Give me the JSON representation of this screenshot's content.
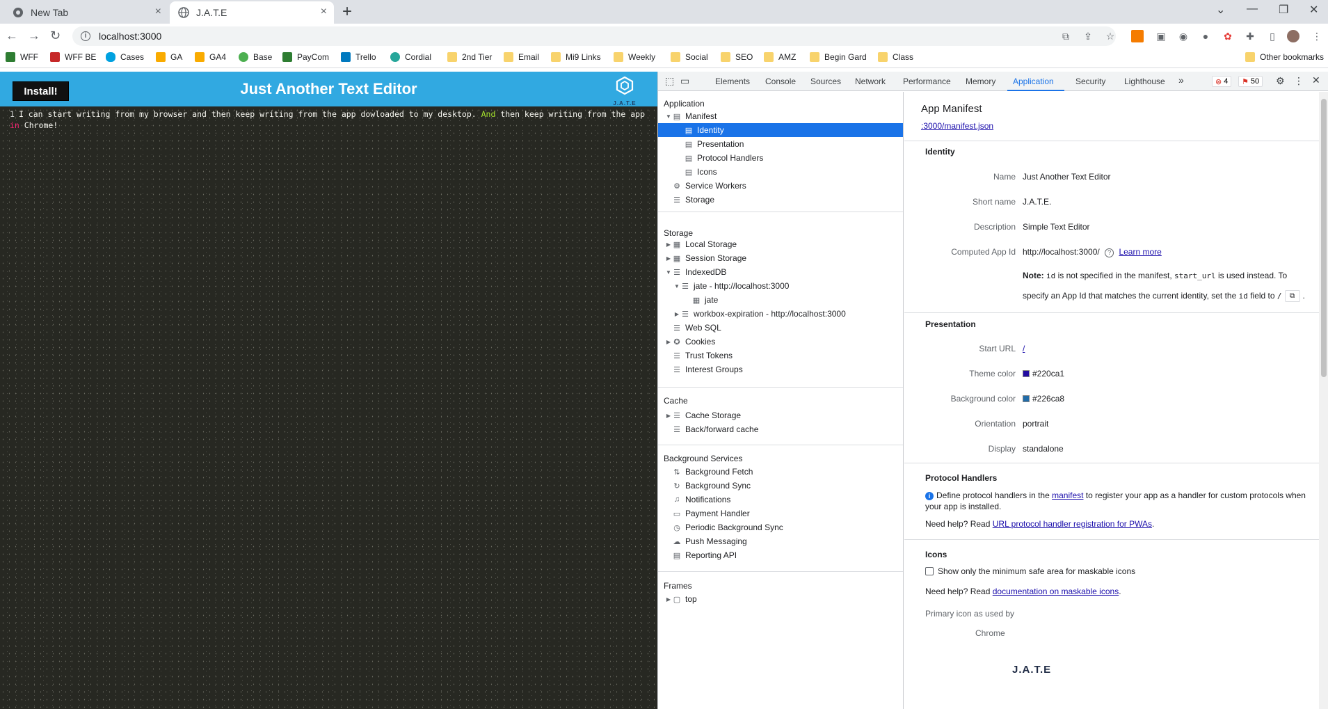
{
  "browser": {
    "tabs": [
      {
        "title": "New Tab",
        "active": false
      },
      {
        "title": "J.A.T.E",
        "active": true
      }
    ],
    "new_tab_symbol": "+",
    "close_symbol": "×",
    "url": "localhost:3000",
    "bookmarks": [
      {
        "label": "WFF",
        "icon": "wff-icon",
        "color": "#2e7d32"
      },
      {
        "label": "WFF BE",
        "icon": "wff-be-icon",
        "color": "#c62828"
      },
      {
        "label": "Cases",
        "icon": "salesforce-cloud-icon",
        "color": "#00a1e0"
      },
      {
        "label": "GA",
        "icon": "google-analytics-icon",
        "color": "#f9ab00"
      },
      {
        "label": "GA4",
        "icon": "google-analytics-icon",
        "color": "#f9ab00"
      },
      {
        "label": "Base",
        "icon": "base-icon",
        "color": "#4caf50"
      },
      {
        "label": "PayCom",
        "icon": "paycom-icon",
        "color": "#2e7d32"
      },
      {
        "label": "Trello",
        "icon": "trello-icon",
        "color": "#0079bf"
      },
      {
        "label": "Cordial",
        "icon": "cordial-icon",
        "color": "#26a69a"
      },
      {
        "label": "2nd Tier",
        "icon": "folder-icon",
        "color": "#f8d36c"
      },
      {
        "label": "Email",
        "icon": "folder-icon",
        "color": "#f8d36c"
      },
      {
        "label": "Mi9 Links",
        "icon": "folder-icon",
        "color": "#f8d36c"
      },
      {
        "label": "Weekly",
        "icon": "folder-icon",
        "color": "#f8d36c"
      },
      {
        "label": "Social",
        "icon": "folder-icon",
        "color": "#f8d36c"
      },
      {
        "label": "SEO",
        "icon": "folder-icon",
        "color": "#f8d36c"
      },
      {
        "label": "AMZ",
        "icon": "folder-icon",
        "color": "#f8d36c"
      },
      {
        "label": "Begin Gard",
        "icon": "folder-icon",
        "color": "#f8d36c"
      },
      {
        "label": "Class",
        "icon": "folder-icon",
        "color": "#f8d36c"
      }
    ],
    "other_bookmarks": "Other bookmarks"
  },
  "app": {
    "install_label": "Install!",
    "title": "Just Another Text Editor",
    "logo_caption": "J.A.T.E",
    "header_color": "#31a9e1",
    "editor": {
      "line_number": "1",
      "text_before_and": "I can start writing from my browser and then keep writing from the app dowloaded to my desktop. ",
      "kw_and": "And",
      "text_mid": " then keep writing from the app ",
      "kw_in": "in",
      "text_end": " Chrome!"
    }
  },
  "devtools": {
    "tabs": [
      "Elements",
      "Console",
      "Sources",
      "Network",
      "Performance",
      "Memory",
      "Application",
      "Security",
      "Lighthouse"
    ],
    "active_tab": "Application",
    "more_symbol": "»",
    "errors_count": "4",
    "warnings_count": "50",
    "sidebar": {
      "application_heading": "Application",
      "application_items": [
        {
          "label": "Manifest",
          "icon": "file-icon",
          "expanded": true
        },
        {
          "label": "Identity",
          "icon": "file-icon",
          "selected": true
        },
        {
          "label": "Presentation",
          "icon": "file-icon"
        },
        {
          "label": "Protocol Handlers",
          "icon": "file-icon"
        },
        {
          "label": "Icons",
          "icon": "file-icon"
        },
        {
          "label": "Service Workers",
          "icon": "gear-icon"
        },
        {
          "label": "Storage",
          "icon": "database-icon"
        }
      ],
      "storage_heading": "Storage",
      "storage_items": [
        {
          "label": "Local Storage",
          "icon": "grid-icon"
        },
        {
          "label": "Session Storage",
          "icon": "grid-icon"
        },
        {
          "label": "IndexedDB",
          "icon": "database-icon"
        },
        {
          "label": "jate - http://localhost:3000",
          "icon": "database-icon"
        },
        {
          "label": "jate",
          "icon": "grid-icon"
        },
        {
          "label": "workbox-expiration - http://localhost:3000",
          "icon": "database-icon"
        },
        {
          "label": "Web SQL",
          "icon": "database-icon"
        },
        {
          "label": "Cookies",
          "icon": "cookie-icon"
        },
        {
          "label": "Trust Tokens",
          "icon": "database-icon"
        },
        {
          "label": "Interest Groups",
          "icon": "database-icon"
        }
      ],
      "cache_heading": "Cache",
      "cache_items": [
        {
          "label": "Cache Storage",
          "icon": "database-icon"
        },
        {
          "label": "Back/forward cache",
          "icon": "database-icon"
        }
      ],
      "bg_heading": "Background Services",
      "bg_items": [
        {
          "label": "Background Fetch",
          "icon": "arrows-updown-icon"
        },
        {
          "label": "Background Sync",
          "icon": "sync-icon"
        },
        {
          "label": "Notifications",
          "icon": "bell-icon"
        },
        {
          "label": "Payment Handler",
          "icon": "card-icon"
        },
        {
          "label": "Periodic Background Sync",
          "icon": "clock-icon"
        },
        {
          "label": "Push Messaging",
          "icon": "cloud-icon"
        },
        {
          "label": "Reporting API",
          "icon": "file-icon"
        }
      ],
      "frames_heading": "Frames",
      "frames_items": [
        {
          "label": "top",
          "icon": "frame-icon"
        }
      ]
    },
    "main": {
      "title": "App Manifest",
      "manifest_link": ":3000/manifest.json",
      "identity": {
        "heading": "Identity",
        "rows": [
          {
            "label": "Name",
            "value": "Just Another Text Editor"
          },
          {
            "label": "Short name",
            "value": "J.A.T.E."
          },
          {
            "label": "Description",
            "value": "Simple Text Editor"
          },
          {
            "label": "Computed App Id",
            "value": "http://localhost:3000/"
          }
        ],
        "learn_more": "Learn more",
        "note_bold": "Note:",
        "note_1a": " ",
        "note_code_id": "id",
        "note_1b": " is not specified in the manifest, ",
        "note_code_start": "start_url",
        "note_1c": " is used instead. To",
        "note_2a": "specify an App Id that matches the current identity, set the ",
        "note_code_id2": "id",
        "note_2b": " field to ",
        "note_code_slash": "/",
        "note_end": "."
      },
      "presentation": {
        "heading": "Presentation",
        "rows": [
          {
            "label": "Start URL",
            "value": "/"
          },
          {
            "label": "Theme color",
            "value": "#220ca1",
            "swatch": "#220ca1"
          },
          {
            "label": "Background color",
            "value": "#226ca8",
            "swatch": "#226ca8"
          },
          {
            "label": "Orientation",
            "value": "portrait"
          },
          {
            "label": "Display",
            "value": "standalone"
          }
        ]
      },
      "protocol_handlers": {
        "heading": "Protocol Handlers",
        "text_a": "Define protocol handlers in the ",
        "link_manifest": "manifest",
        "text_b": " to register your app as a handler for custom protocols when",
        "text_c": "your app is installed.",
        "help_a": "Need help? Read ",
        "help_link": "URL protocol handler registration for PWAs",
        "help_end": "."
      },
      "icons": {
        "heading": "Icons",
        "checkbox_label": "Show only the minimum safe area for maskable icons",
        "help_a": "Need help? Read ",
        "help_link": "documentation on maskable icons",
        "help_end": ".",
        "primary_label": "Primary icon as used by",
        "chrome_label": "Chrome",
        "icon_caption": "J.A.T.E"
      }
    }
  }
}
